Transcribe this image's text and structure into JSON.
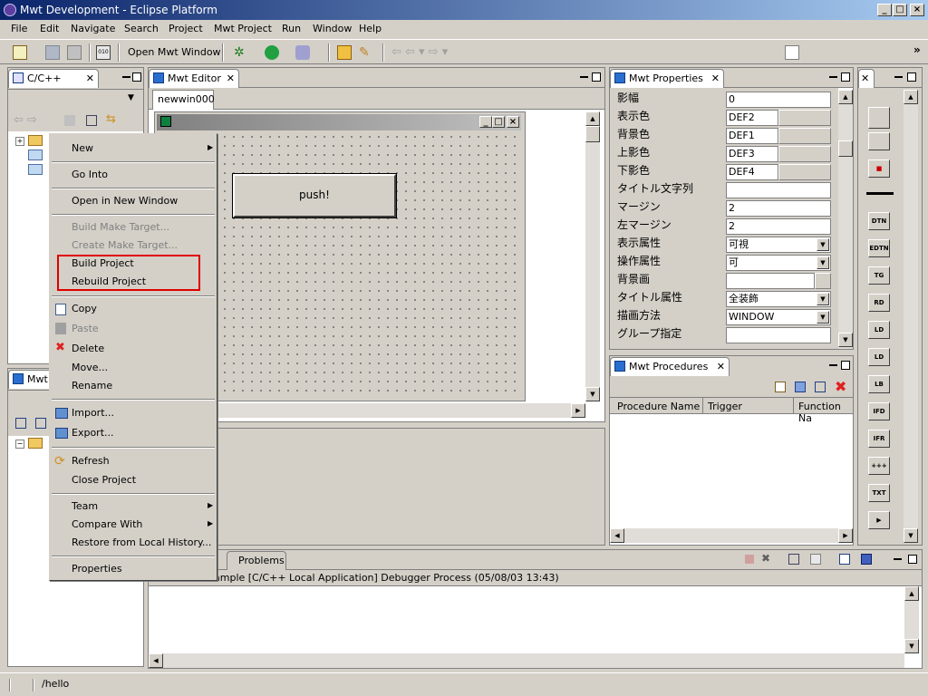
{
  "window": {
    "title": "Mwt Development - Eclipse Platform"
  },
  "menubar": [
    "File",
    "Edit",
    "Navigate",
    "Search",
    "Project",
    "Mwt Project",
    "Run",
    "Window",
    "Help"
  ],
  "toolbar": {
    "open_window_label": "Open Mwt Window"
  },
  "project_view": {
    "tab_label": "C/C++ Pr..."
  },
  "mwt_view": {
    "tab_label": "Mwt"
  },
  "editor": {
    "tab_label": "Mwt Editor",
    "subtab": "newwin000",
    "button_label": "push!"
  },
  "properties": {
    "tab_label": "Mwt Properties",
    "rows": [
      {
        "label": "影幅",
        "value": "0"
      },
      {
        "label": "表示色",
        "value": "DEF2"
      },
      {
        "label": "背景色",
        "value": "DEF1"
      },
      {
        "label": "上影色",
        "value": "DEF3"
      },
      {
        "label": "下影色",
        "value": "DEF4"
      },
      {
        "label": "タイトル文字列",
        "value": ""
      },
      {
        "label": "マージン",
        "value": "2"
      },
      {
        "label": "左マージン",
        "value": "2"
      },
      {
        "label": "表示属性",
        "value": "可視"
      },
      {
        "label": "操作属性",
        "value": "可"
      },
      {
        "label": "背景画",
        "value": ""
      },
      {
        "label": "タイトル属性",
        "value": "全装飾"
      },
      {
        "label": "描画方法",
        "value": "WINDOW"
      },
      {
        "label": "グループ指定",
        "value": ""
      }
    ]
  },
  "procedures": {
    "tab_label": "Mwt Procedures",
    "columns": [
      "Procedure Name",
      "Trigger",
      "Function Na"
    ]
  },
  "palette": [
    "DTN",
    "EDTN",
    "TG",
    "RD",
    "LD",
    "LD",
    "LB",
    "IFD",
    "IFR",
    "+++",
    "TXT"
  ],
  "console": {
    "tab_problems": "Problems",
    "text": "ample [C/C++ Local Application] Debugger Process (05/08/03 13:43)"
  },
  "context_menu": {
    "items": [
      {
        "label": "New",
        "sub": true
      },
      {
        "label": "Go Into"
      },
      {
        "label": "Open in New Window"
      },
      {
        "label": "Build Make Target...",
        "disabled": true
      },
      {
        "label": "Create Make Target...",
        "disabled": true
      },
      {
        "label": "Build Project"
      },
      {
        "label": "Rebuild Project"
      },
      {
        "label": "Copy"
      },
      {
        "label": "Paste",
        "disabled": true
      },
      {
        "label": "Delete"
      },
      {
        "label": "Move..."
      },
      {
        "label": "Rename"
      },
      {
        "label": "Import..."
      },
      {
        "label": "Export..."
      },
      {
        "label": "Refresh"
      },
      {
        "label": "Close Project"
      },
      {
        "label": "Team",
        "sub": true
      },
      {
        "label": "Compare With",
        "sub": true
      },
      {
        "label": "Restore from Local History..."
      },
      {
        "label": "Properties"
      }
    ]
  },
  "status": {
    "path": "/hello"
  }
}
